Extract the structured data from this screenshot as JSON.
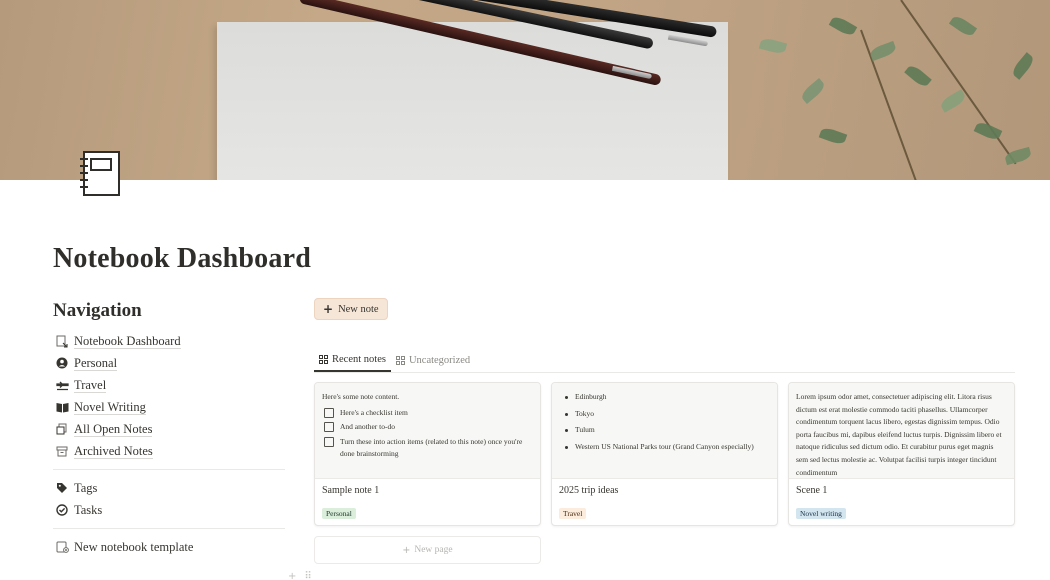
{
  "cover": {
    "image": "stationery-pens-paper-leaves"
  },
  "page_icon": "notebook-icon",
  "page": {
    "title": "Notebook Dashboard"
  },
  "navigation": {
    "heading": "Navigation",
    "items": [
      {
        "label": "Notebook Dashboard",
        "icon": "page-link-icon"
      },
      {
        "label": "Personal",
        "icon": "person-circle-icon"
      },
      {
        "label": "Travel",
        "icon": "airplane-icon"
      },
      {
        "label": "Novel Writing",
        "icon": "open-book-icon"
      },
      {
        "label": "All Open Notes",
        "icon": "notes-stack-icon"
      },
      {
        "label": "Archived Notes",
        "icon": "archive-box-icon"
      }
    ],
    "secondary": [
      {
        "label": "Tags",
        "icon": "tag-icon"
      },
      {
        "label": "Tasks",
        "icon": "check-circle-icon"
      }
    ],
    "template": {
      "label": "New notebook template",
      "icon": "template-icon"
    }
  },
  "actions": {
    "new_note": "New note"
  },
  "tabs": [
    {
      "label": "Recent notes",
      "active": true
    },
    {
      "label": "Uncategorized",
      "active": false
    }
  ],
  "cards": [
    {
      "title": "Sample note 1",
      "tag": {
        "label": "Personal",
        "bg": "#dbeddb",
        "fg": "#1c3829"
      },
      "preview_text": "Here's some note content.",
      "todos": [
        "Here's a checklist item",
        "And another to-do",
        "Turn these into action items (related to this note) once you're done brainstorming"
      ]
    },
    {
      "title": "2025 trip ideas",
      "tag": {
        "label": "Travel",
        "bg": "#fbecdd",
        "fg": "#49290e"
      },
      "bullets": [
        "Edinburgh",
        "Tokyo",
        "Tulum",
        "Western US National Parks tour (Grand Canyon especially)"
      ]
    },
    {
      "title": "Scene 1",
      "tag": {
        "label": "Novel writing",
        "bg": "#d3e5ef",
        "fg": "#183347"
      },
      "preview_text": "Lorem ipsum odor amet, consectetuer adipiscing elit. Litora risus dictum est erat molestie commodo taciti phasellus. Ullamcorper condimentum torquent lacus libero, egestas dignissim tempus. Odio porta faucibus mi, dapibus eleifend luctus turpis. Dignissim libero et natoque ridiculus sed dictum odio. Et curabitur purus eget magnis sem sed lectus molestie ac. Volutpat facilisi turpis integer tincidunt condimentum"
    }
  ],
  "new_page": "New page"
}
